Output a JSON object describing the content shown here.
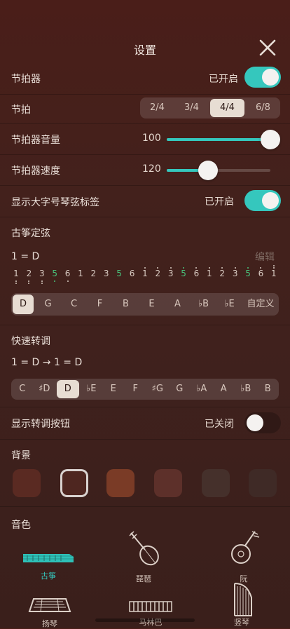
{
  "header": {
    "title": "设置"
  },
  "metronome": {
    "label": "节拍器",
    "status": "已开启"
  },
  "beat": {
    "label": "节拍",
    "options": [
      "2/4",
      "3/4",
      "4/4",
      "6/8"
    ],
    "selected": "4/4"
  },
  "volume": {
    "label": "节拍器音量",
    "value": "100",
    "level": 1.0
  },
  "speed": {
    "label": "节拍器速度",
    "value": "120",
    "level": 0.4
  },
  "large_labels": {
    "label": "显示大字号琴弦标签",
    "status": "已开启"
  },
  "tuning": {
    "title": "古筝定弦",
    "key": "1 = D",
    "edit": "编辑",
    "notes": [
      "1",
      "2",
      "3",
      "5",
      "6",
      "1",
      "2",
      "3",
      "5",
      "6",
      "1",
      "2",
      "3",
      "5",
      "6",
      "1",
      "2",
      "3",
      "5",
      "6",
      "1"
    ],
    "keys": [
      "D",
      "G",
      "C",
      "F",
      "B",
      "E",
      "A",
      "♭B",
      "♭E",
      "自定义"
    ],
    "selected": "D"
  },
  "transpose": {
    "title": "快速转调",
    "formula": "1 = D → 1 = D",
    "keys": [
      "C",
      "♯D",
      "D",
      "♭E",
      "E",
      "F",
      "♯G",
      "G",
      "♭A",
      "A",
      "♭B",
      "B"
    ],
    "selected": "D"
  },
  "transpose_button": {
    "label": "显示转调按钮",
    "status": "已关闭"
  },
  "background": {
    "title": "背景",
    "colors": [
      "#5a2a22",
      "#4e2620",
      "#7a3b26",
      "#5d302a",
      "#45302b",
      "#3f2a26"
    ],
    "selected": 1
  },
  "timbre": {
    "title": "音色",
    "instruments": [
      {
        "name": "古筝",
        "icon": "guzheng-icon"
      },
      {
        "name": "琵琶",
        "icon": "pipa-icon"
      },
      {
        "name": "阮",
        "icon": "ruan-icon"
      },
      {
        "name": "扬琴",
        "icon": "yangqin-icon"
      },
      {
        "name": "马林巴",
        "icon": "marimba-icon"
      },
      {
        "name": "竖琴",
        "icon": "harp-icon"
      }
    ],
    "selected": "古筝"
  },
  "colors": {
    "accent": "#35c7bd",
    "green_note": "#48c27a"
  }
}
